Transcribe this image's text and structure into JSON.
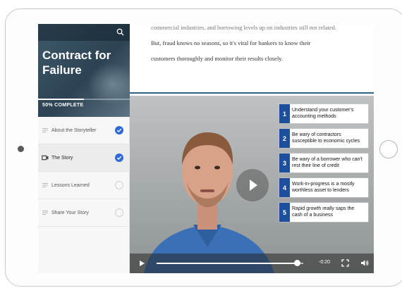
{
  "course": {
    "title": "Contract for Failure",
    "progress_label": "50% COMPLETE",
    "progress_fraction": 0.5
  },
  "nav": {
    "items": [
      {
        "label": "About the Storyteller",
        "completed": true,
        "active": false
      },
      {
        "label": "The Story",
        "completed": true,
        "active": true
      },
      {
        "label": "Lessons Learned",
        "completed": false,
        "active": false
      },
      {
        "label": "Share Your Story",
        "completed": false,
        "active": false
      }
    ]
  },
  "content": {
    "partial_line": "commercial industries, and borrowing levels up on industries still not related.",
    "line1": "But, fraud knows no seasons, so it's vital for bankers to know their",
    "line2": "customers thoroughly and monitor their results closely."
  },
  "video": {
    "steps": [
      {
        "num": "1",
        "text": "Understand your customer's accounting methods"
      },
      {
        "num": "2",
        "text": "Be wary of contractors susceptible to economic cycles"
      },
      {
        "num": "3",
        "text": "Be wary of a borrower who can't rest their line of credit"
      },
      {
        "num": "4",
        "text": "Work-in-progress is a mostly worthless asset to lenders"
      },
      {
        "num": "5",
        "text": "Rapid growth really saps the cash of a business"
      }
    ],
    "time_remaining": "-0:20",
    "seek_fraction": 0.96
  },
  "colors": {
    "accent": "#2f6ad8",
    "step_blue": "#1d4f9c",
    "divider": "#2f5e86"
  }
}
